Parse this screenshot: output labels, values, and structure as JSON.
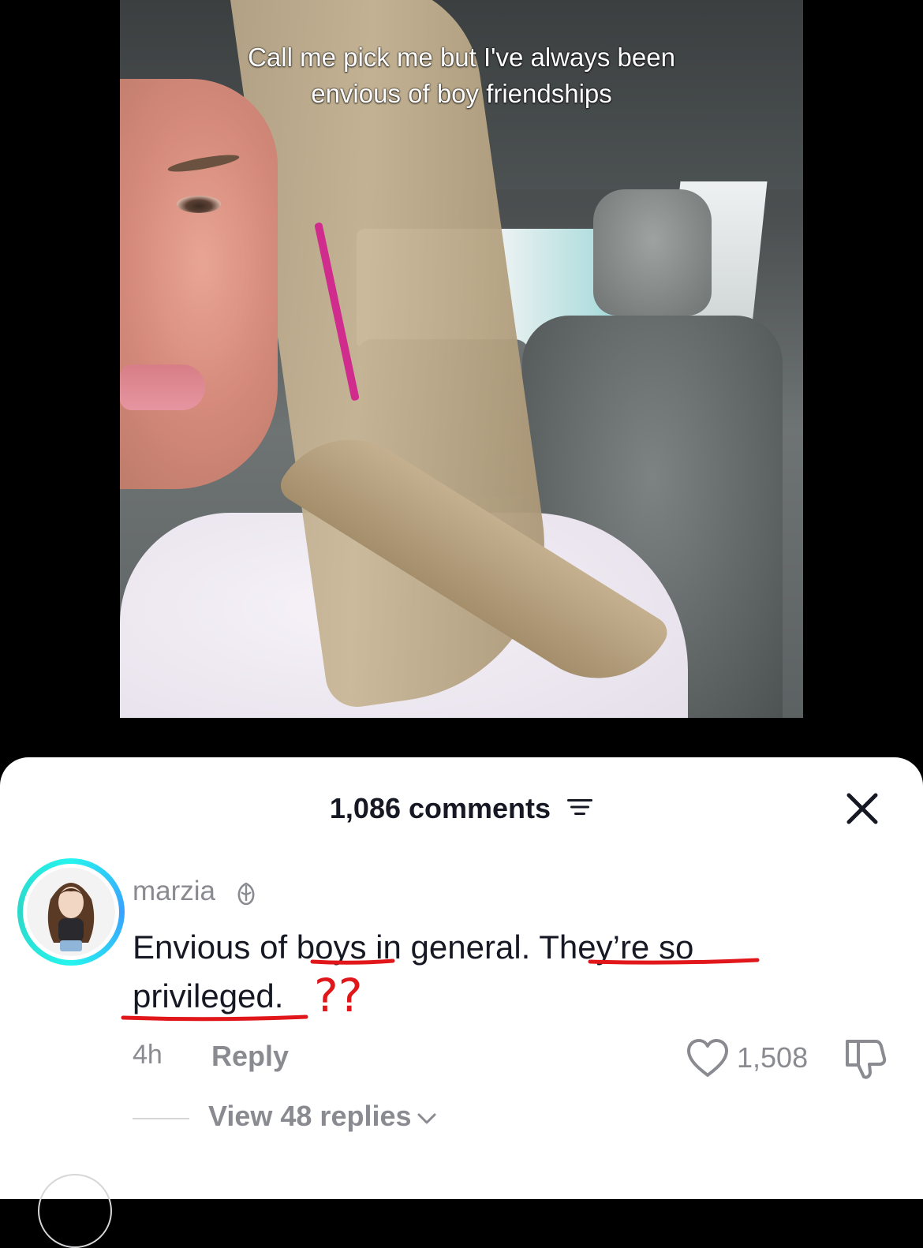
{
  "video": {
    "caption": "Call me pick me but I've always been envious of boy friendships"
  },
  "comments": {
    "count_label": "1,086 comments",
    "filter_icon": "filter-icon",
    "close_icon": "close-icon"
  },
  "comment": {
    "username": "marzia",
    "badge_icon": "badge-icon",
    "text_part1": "Envious of ",
    "text_boys": "boys",
    "text_part2": " in general. ",
    "text_theyre": "They’re so",
    "text_privileged": "privileged.",
    "time": "4h",
    "reply_label": "Reply",
    "like_count": "1,508",
    "view_replies_label": "View 48 replies"
  },
  "annotation": {
    "question_marks": "??",
    "color": "#e0161b"
  },
  "colors": {
    "text_primary": "#161823",
    "text_secondary": "#8a8b91",
    "avatar_ring": "#25f4ee"
  }
}
